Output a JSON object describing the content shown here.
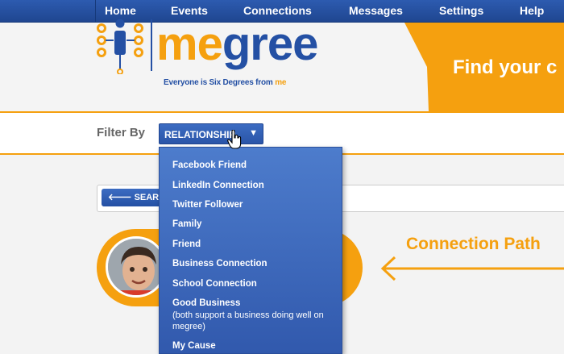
{
  "nav": {
    "items": [
      "Home",
      "Events",
      "Connections",
      "Messages",
      "Settings",
      "Help"
    ]
  },
  "logo": {
    "name_part1": "me",
    "name_part2": "gree",
    "tagline_part1": "Everyone is Six",
    "tagline_part2": "Degrees from",
    "tagline_part3": "me"
  },
  "banner": {
    "text": "Find your c"
  },
  "filter": {
    "label": "Filter By",
    "selected": "RELATIONSHIP",
    "options": [
      "Facebook Friend",
      "LinkedIn Connection",
      "Twitter Follower",
      "Family",
      "Friend",
      "Business Connection",
      "School Connection",
      "Good Business",
      "My Cause"
    ],
    "good_business_note": "(both support a business doing well on megree)"
  },
  "search": {
    "button_label": "SEARCH"
  },
  "connection": {
    "title": "Connection Path"
  },
  "colors": {
    "brand_blue": "#2450a4",
    "brand_orange": "#f5a00f"
  }
}
